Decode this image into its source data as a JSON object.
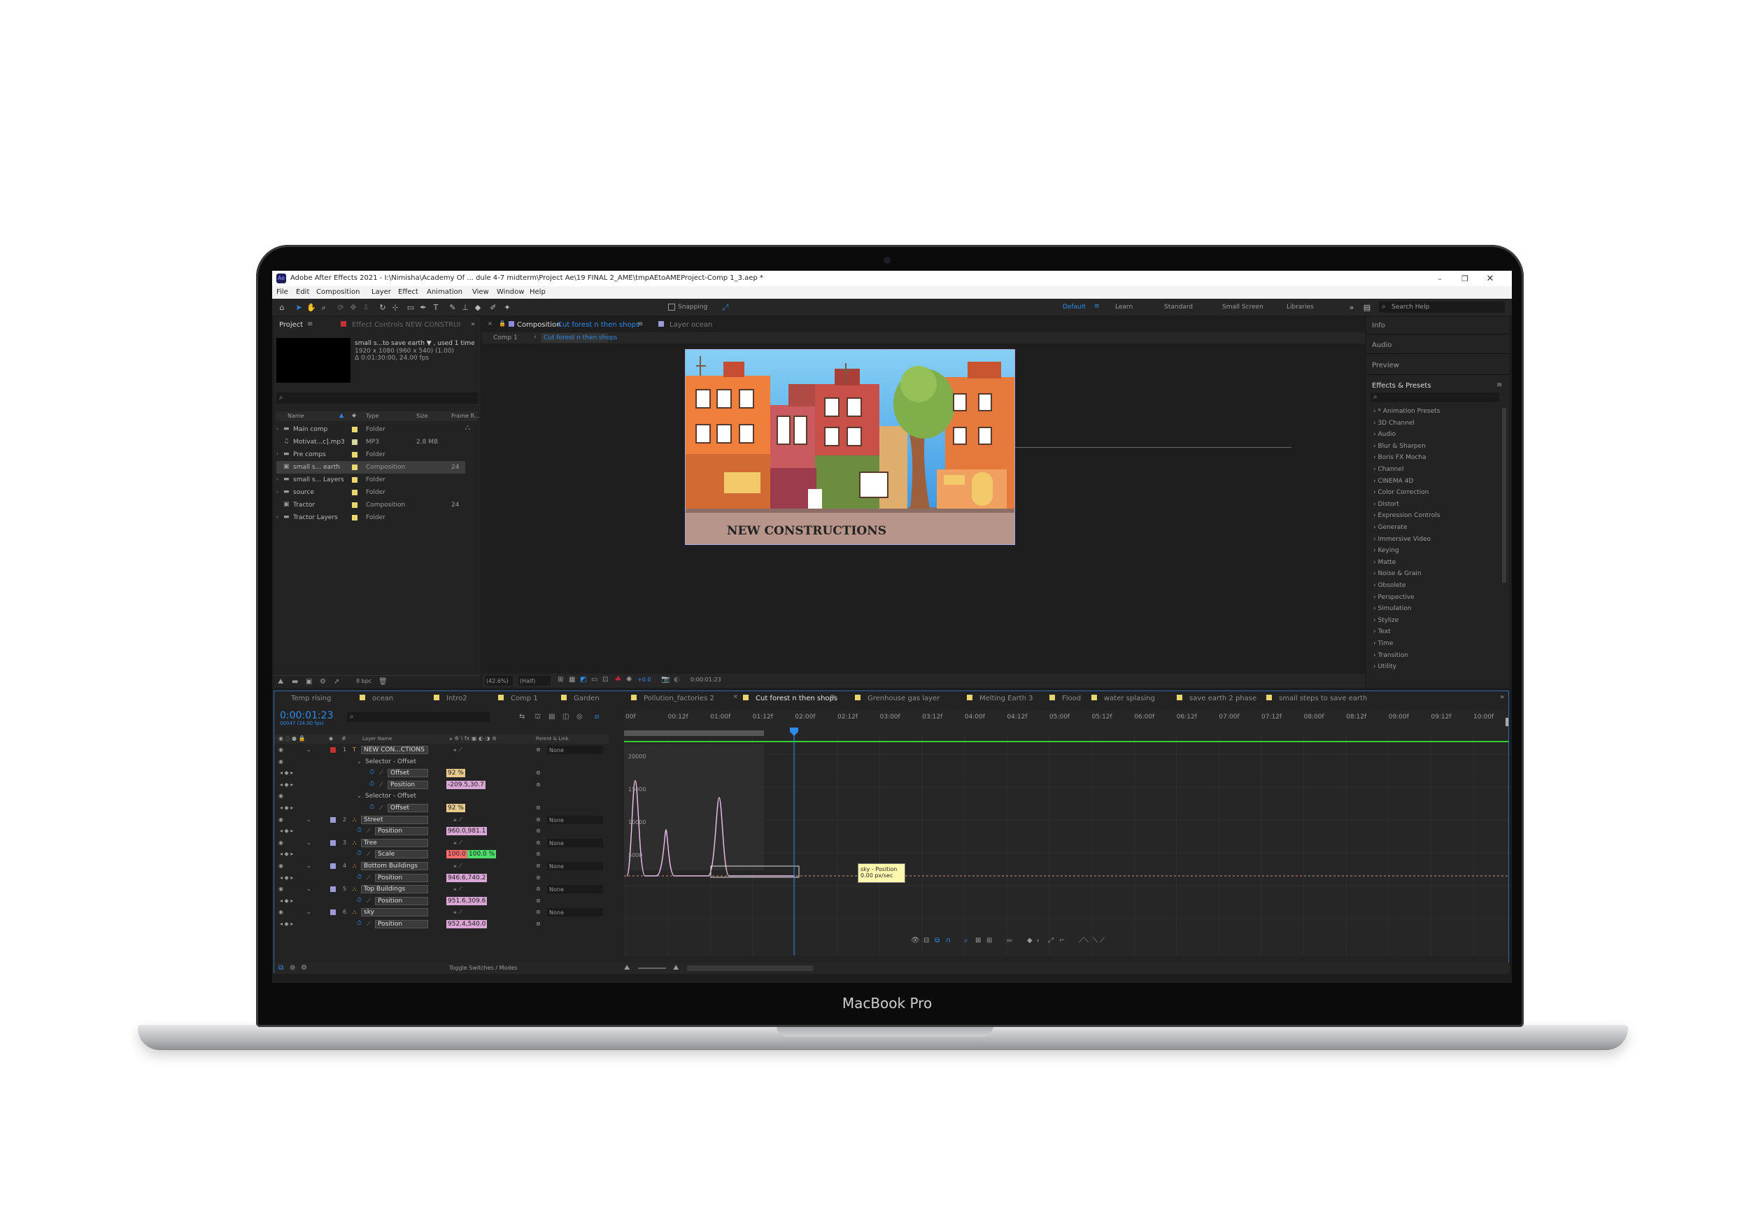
{
  "window": {
    "title": "Adobe After Effects 2021 - I:\\Nimisha\\Academy Of ... dule 4-7 midterm\\Project Ae\\19 FINAL 2_AME\\tmpAEtoAMEProject-Comp 1_3.aep *",
    "app_icon": "Ae"
  },
  "menu": [
    "File",
    "Edit",
    "Composition",
    "Layer",
    "Effect",
    "Animation",
    "View",
    "Window",
    "Help"
  ],
  "toolbar": {
    "snapping": "Snapping",
    "workspaces": [
      "Default",
      "Learn",
      "Standard",
      "Small Screen",
      "Libraries"
    ],
    "search_placeholder": "Search Help"
  },
  "project": {
    "tab": "Project",
    "effect_controls_tab": "Effect Controls NEW CONSTRUI",
    "item_name": "small s...to save earth ▼ , used 1 time",
    "item_size": "1920 x 1080  (960 x 540) (1.00)",
    "item_duration": "Δ 0:01:30:00, 24.00 fps",
    "search_placeholder": "",
    "columns": [
      "Name",
      "Type",
      "Size",
      "Frame R..."
    ],
    "items": [
      {
        "name": "Main comp",
        "type": "Folder",
        "size": "",
        "frame": ""
      },
      {
        "name": "Motivat...c].mp3",
        "type": "MP3",
        "size": "2.8 MB",
        "frame": ""
      },
      {
        "name": "Pre comps",
        "type": "Folder",
        "size": "",
        "frame": ""
      },
      {
        "name": "small s... earth",
        "type": "Composition",
        "size": "",
        "frame": "24"
      },
      {
        "name": "small s... Layers",
        "type": "Folder",
        "size": "",
        "frame": ""
      },
      {
        "name": "source",
        "type": "Folder",
        "size": "",
        "frame": ""
      },
      {
        "name": "Tractor",
        "type": "Composition",
        "size": "",
        "frame": "24"
      },
      {
        "name": "Tractor Layers",
        "type": "Folder",
        "size": "",
        "frame": ""
      }
    ],
    "bpc": "8 bpc"
  },
  "composition": {
    "tab_label": "Composition",
    "tab_name": "Cut forest n then shops",
    "layer_tab": "Layer ocean",
    "breadcrumb": [
      "Comp 1",
      "Cut forest n then shops"
    ],
    "text_overlay": "NEW CONSTRUCTIONS",
    "zoom": "(42.6%)",
    "resolution": "(Half)",
    "exposure": "+0.0",
    "timecode": "0:00:01:23"
  },
  "right_panel": {
    "tabs": [
      "Info",
      "Audio",
      "Preview",
      "Effects & Presets"
    ],
    "search_placeholder": "",
    "effects": [
      "* Animation Presets",
      "3D Channel",
      "Audio",
      "Blur & Sharpen",
      "Boris FX Mocha",
      "Channel",
      "CINEMA 4D",
      "Color Correction",
      "Distort",
      "Expression Controls",
      "Generate",
      "Immersive Video",
      "Keying",
      "Matte",
      "Noise & Grain",
      "Obsolete",
      "Perspective",
      "Simulation",
      "Stylize",
      "Text",
      "Time",
      "Transition",
      "Utility"
    ]
  },
  "timeline": {
    "tabs": [
      "Temp rising",
      "ocean",
      "Intro2",
      "Comp 1",
      "Garden",
      "Pollution_factories 2",
      "Cut forest n then shops",
      "Grenhouse gas layer",
      "Melting Earth 3",
      "Flood",
      "water splasing",
      "save earth 2 phase",
      "small steps to save earth"
    ],
    "timecode": "0:00:01:23",
    "frame_info": "00047 (24.00 fps)",
    "search_placeholder": "",
    "columns": {
      "layer_name": "Layer Name",
      "parent": "Parent & Link"
    },
    "ruler": [
      "00f",
      "00:12f",
      "01:00f",
      "01:12f",
      "02:00f",
      "02:12f",
      "03:00f",
      "03:12f",
      "04:00f",
      "04:12f",
      "05:00f",
      "05:12f",
      "06:00f",
      "06:12f",
      "07:00f",
      "07:12f",
      "08:00f",
      "08:12f",
      "09:00f",
      "09:12f",
      "10:00f"
    ],
    "graph_labels": [
      "20000",
      "15000",
      "10000",
      "5000"
    ],
    "tooltip": [
      "sky - Position",
      "0.00 px/sec"
    ],
    "toggle": "Toggle Switches / Modes",
    "rows": [
      {
        "kind": "layer",
        "num": "1",
        "name": "NEW CON...CTIONS",
        "parent": "None",
        "color": "#c43232"
      },
      {
        "kind": "group",
        "name": "Selector - Offset"
      },
      {
        "kind": "prop",
        "name": "Offset",
        "value": "92 %",
        "vcolor": "#e7c98a"
      },
      {
        "kind": "prop",
        "name": "Position",
        "value": "-209.5,30.7",
        "vcolor": "#d9a6d6"
      },
      {
        "kind": "group",
        "name": "Selector - Offset"
      },
      {
        "kind": "prop",
        "name": "Offset",
        "value": "92 %",
        "vcolor": "#e7c98a"
      },
      {
        "kind": "layer",
        "num": "2",
        "name": "Street",
        "parent": "None",
        "color": "#9b9bd6"
      },
      {
        "kind": "prop",
        "name": "Position",
        "value": "960.0,981.1",
        "vcolor": "#d9a6d6"
      },
      {
        "kind": "layer",
        "num": "3",
        "name": "Tree",
        "parent": "None",
        "color": "#9b9bd6"
      },
      {
        "kind": "prop",
        "name": "Scale",
        "value": "100.0",
        "value2": "100.0 %",
        "vcolor": "#ff6b6b",
        "vcolor2": "#4cdc6a"
      },
      {
        "kind": "layer",
        "num": "4",
        "name": "Bottom Buildings",
        "parent": "None",
        "color": "#9b9bd6"
      },
      {
        "kind": "prop",
        "name": "Position",
        "value": "946.6,740.2",
        "vcolor": "#d9a6d6"
      },
      {
        "kind": "layer",
        "num": "5",
        "name": "Top Buildings",
        "parent": "None",
        "color": "#9b9bd6"
      },
      {
        "kind": "prop",
        "name": "Position",
        "value": "951.6,309.6",
        "vcolor": "#d9a6d6"
      },
      {
        "kind": "layer",
        "num": "6",
        "name": "sky",
        "parent": "None",
        "color": "#9b9bd6"
      },
      {
        "kind": "prop",
        "name": "Position",
        "value": "952.4,540.0",
        "vcolor": "#d9a6d6"
      }
    ]
  },
  "device": {
    "brand": "MacBook Pro"
  },
  "colors": {
    "accent": "#2d8ceb",
    "panel": "#232323",
    "background": "#1d1d1d"
  }
}
